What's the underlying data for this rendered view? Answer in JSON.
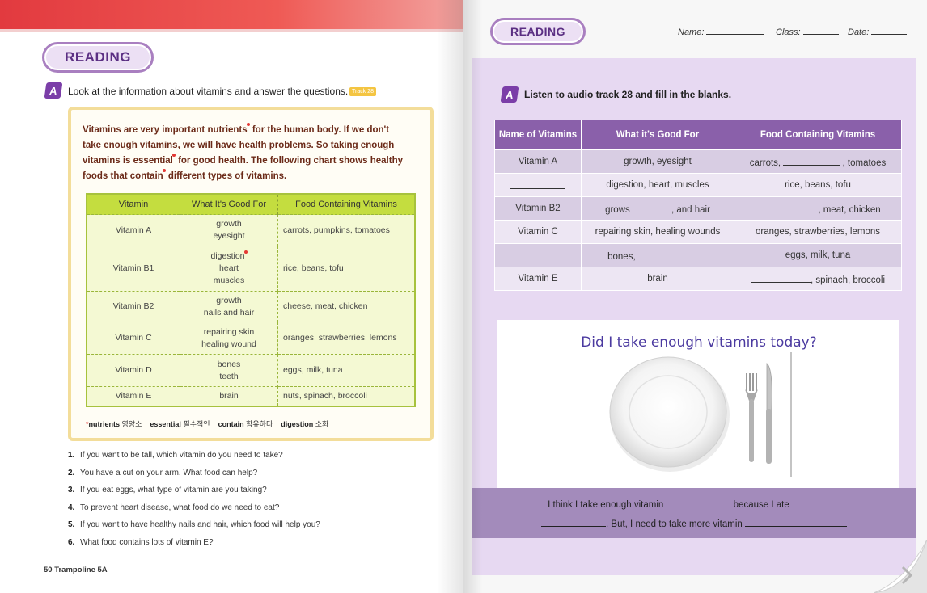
{
  "left_page": {
    "section_label": "READING",
    "badge": "A",
    "instruction": "Look at the information about vitamins and answer the questions.",
    "track_tag": "Track 28",
    "paragraph": {
      "p1": "Vitamins are very important nutrients",
      "p2": " for the human body. If we don't take enough vitamins, we will have health problems. So taking enough vitamins is essential",
      "p3": " for good health. The following chart shows healthy foods that contain",
      "p4": " different types of vitamins."
    },
    "table": {
      "headers": [
        "Vitamin",
        "What It's Good For",
        "Food Containing Vitamins"
      ],
      "rows": [
        {
          "vitamin": "Vitamin A",
          "good_for": [
            "growth",
            "eyesight"
          ],
          "food": "carrots, pumpkins, tomatoes"
        },
        {
          "vitamin": "Vitamin B1",
          "good_for": [
            "digestion",
            "heart",
            "muscles"
          ],
          "food": "rice, beans, tofu"
        },
        {
          "vitamin": "Vitamin B2",
          "good_for": [
            "growth",
            "nails and hair"
          ],
          "food": "cheese, meat, chicken"
        },
        {
          "vitamin": "Vitamin C",
          "good_for": [
            "repairing skin",
            "healing wound"
          ],
          "food": "oranges, strawberries, lemons"
        },
        {
          "vitamin": "Vitamin D",
          "good_for": [
            "bones",
            "teeth"
          ],
          "food": "eggs, milk, tuna"
        },
        {
          "vitamin": "Vitamin E",
          "good_for": [
            "brain"
          ],
          "food": "nuts, spinach, broccoli"
        }
      ]
    },
    "glossary": [
      {
        "word": "nutrients",
        "meaning": "영양소"
      },
      {
        "word": "essential",
        "meaning": "필수적인"
      },
      {
        "word": "contain",
        "meaning": "함유하다"
      },
      {
        "word": "digestion",
        "meaning": "소화"
      }
    ],
    "questions": [
      {
        "num": "1.",
        "text": "If you want to be tall, which vitamin do you need to take?"
      },
      {
        "num": "2.",
        "text": "You have a cut on your arm. What food can help?"
      },
      {
        "num": "3.",
        "text": "If you eat eggs, what type of vitamin are you taking?"
      },
      {
        "num": "4.",
        "text": "To prevent heart disease, what food do we need to eat?"
      },
      {
        "num": "5.",
        "text": "If you want to have healthy nails and hair, which food will help you?"
      },
      {
        "num": "6.",
        "text": "What food contains lots of vitamin E?"
      }
    ],
    "footer": "50 Trampoline 5A"
  },
  "right_page": {
    "section_label": "READING",
    "header": {
      "name_label": "Name:",
      "class_label": "Class:",
      "date_label": "Date:"
    },
    "badge": "A",
    "instruction": "Listen to audio track 28 and fill in the blanks.",
    "table": {
      "headers": [
        "Name of Vitamins",
        "What it's Good For",
        "Food Containing Vitamins"
      ],
      "rows": [
        {
          "c1": "Vitamin A",
          "c2": "growth, eyesight",
          "c3a": "carrots, ",
          "c3b": " , tomatoes"
        },
        {
          "c1": "",
          "c2": "digestion, heart, muscles",
          "c3a": "rice, beans, tofu",
          "c3b": ""
        },
        {
          "c1": "Vitamin B2",
          "c2a": "grows ",
          "c2b": ", and hair",
          "c3a": "",
          "c3b": ", meat, chicken"
        },
        {
          "c1": "Vitamin C",
          "c2": "repairing skin, healing wounds",
          "c3a": "oranges, strawberries, lemons",
          "c3b": ""
        },
        {
          "c1": "",
          "c2a": "bones, ",
          "c2b": "",
          "c3a": "eggs, milk, tuna",
          "c3b": ""
        },
        {
          "c1": "Vitamin E",
          "c2": "brain",
          "c3a": "",
          "c3b": ", spinach, broccoli"
        }
      ]
    },
    "card_title": "Did I take enough vitamins today?",
    "summary": {
      "l1a": "I think I take enough vitamin ",
      "l1b": " because I ate ",
      "l2a": ". But, I need to take more vitamin "
    }
  }
}
